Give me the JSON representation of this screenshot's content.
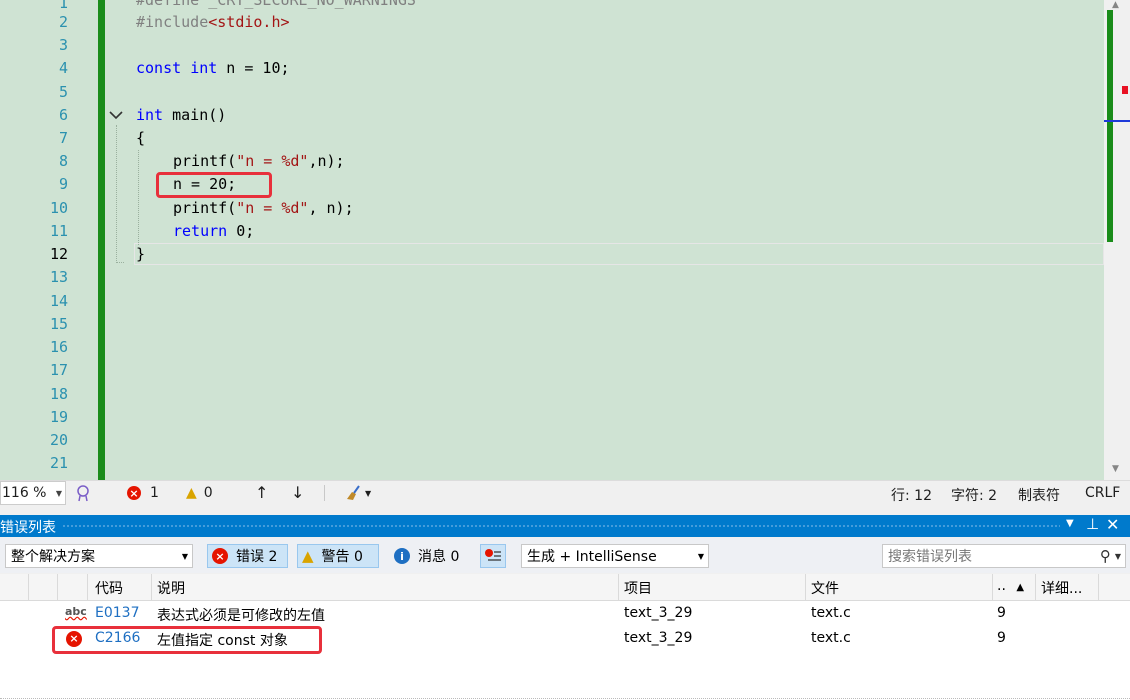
{
  "editor": {
    "line_numbers": [
      "1",
      "2",
      "3",
      "4",
      "5",
      "6",
      "7",
      "8",
      "9",
      "10",
      "11",
      "12",
      "13",
      "14",
      "15",
      "16",
      "17",
      "18",
      "19",
      "20",
      "21"
    ],
    "current_line": 12,
    "lines": {
      "l1_pre": "#define ",
      "l1_macro": "_CRT_SECURE_NO_WARNINGS",
      "l2_pre": "#include",
      "l2_hdr": "<stdio.h>",
      "l4_kw1": "const",
      "l4_kw2": "int",
      "l4_rest": " n = 10;",
      "l6_kw": "int",
      "l6_rest": " main()",
      "l7": "{",
      "l8_a": "printf(",
      "l8_s": "\"n = %d\"",
      "l8_b": ",n);",
      "l9": "n = 20;",
      "l10_a": "printf(",
      "l10_s": "\"n = %d\"",
      "l10_b": ", n);",
      "l11_kw": "return",
      "l11_rest": " 0;",
      "l12": "}"
    }
  },
  "statusbar": {
    "zoom": "116 %",
    "errors": "1",
    "warnings": "0",
    "line": "行: 12",
    "char": "字符: 2",
    "tabs": "制表符",
    "eol": "CRLF"
  },
  "error_list": {
    "title": "错误列表",
    "scope": "整个解决方案",
    "errors_btn": "错误 2",
    "warnings_btn": "警告 0",
    "messages_btn": "消息 0",
    "build_filter": "生成 + IntelliSense",
    "search_placeholder": "搜索错误列表",
    "columns": {
      "code": "代码",
      "desc": "说明",
      "project": "项目",
      "file": "文件",
      "line": "..",
      "detail": "详细..."
    },
    "rows": [
      {
        "code": "E0137",
        "desc": "表达式必须是可修改的左值",
        "project": "text_3_29",
        "file": "text.c",
        "line": "9"
      },
      {
        "code": "C2166",
        "desc": "左值指定 const 对象",
        "project": "text_3_29",
        "file": "text.c",
        "line": "9"
      }
    ]
  },
  "colors": {
    "editor_bg": "#cfe3d3",
    "accent": "#007acc",
    "change_bar": "#1a8c1a",
    "highlight": "#e8303b"
  }
}
